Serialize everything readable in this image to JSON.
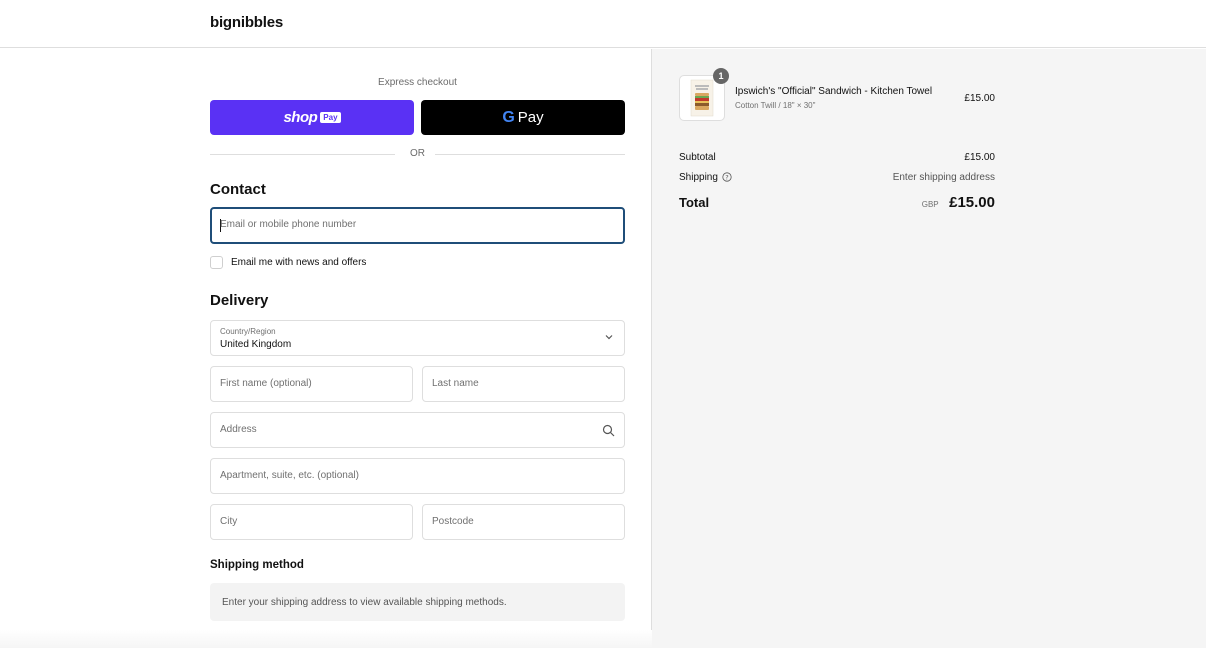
{
  "header": {
    "brand": "bignibbles"
  },
  "express": {
    "label": "Express checkout",
    "shoppay": {
      "word": "shop",
      "tag": "Pay"
    },
    "gpay": {
      "g": "G",
      "word": "Pay"
    },
    "or": "OR"
  },
  "contact": {
    "title": "Contact",
    "email_placeholder": "Email or mobile phone number",
    "newsletter_label": "Email me with news and offers",
    "newsletter_checked": false
  },
  "delivery": {
    "title": "Delivery",
    "country_label": "Country/Region",
    "country_value": "United Kingdom",
    "first_name_placeholder": "First name (optional)",
    "last_name_placeholder": "Last name",
    "address_placeholder": "Address",
    "apartment_placeholder": "Apartment, suite, etc. (optional)",
    "city_placeholder": "City",
    "postcode_placeholder": "Postcode"
  },
  "shipping_method": {
    "title": "Shipping method",
    "message": "Enter your shipping address to view available shipping methods."
  },
  "order": {
    "item": {
      "quantity": "1",
      "name": "Ipswich's \"Official\" Sandwich - Kitchen Towel",
      "variant": "Cotton Twill / 18\" × 30\"",
      "price": "£15.00"
    },
    "subtotal_label": "Subtotal",
    "subtotal_value": "£15.00",
    "shipping_label": "Shipping",
    "shipping_value": "Enter shipping address",
    "total_label": "Total",
    "currency": "GBP",
    "total_value": "£15.00"
  },
  "colors": {
    "shoppay": "#5a31f4",
    "gpay": "#000000",
    "focus_border": "#1f4e79",
    "sidebar_bg": "#f5f5f5"
  }
}
